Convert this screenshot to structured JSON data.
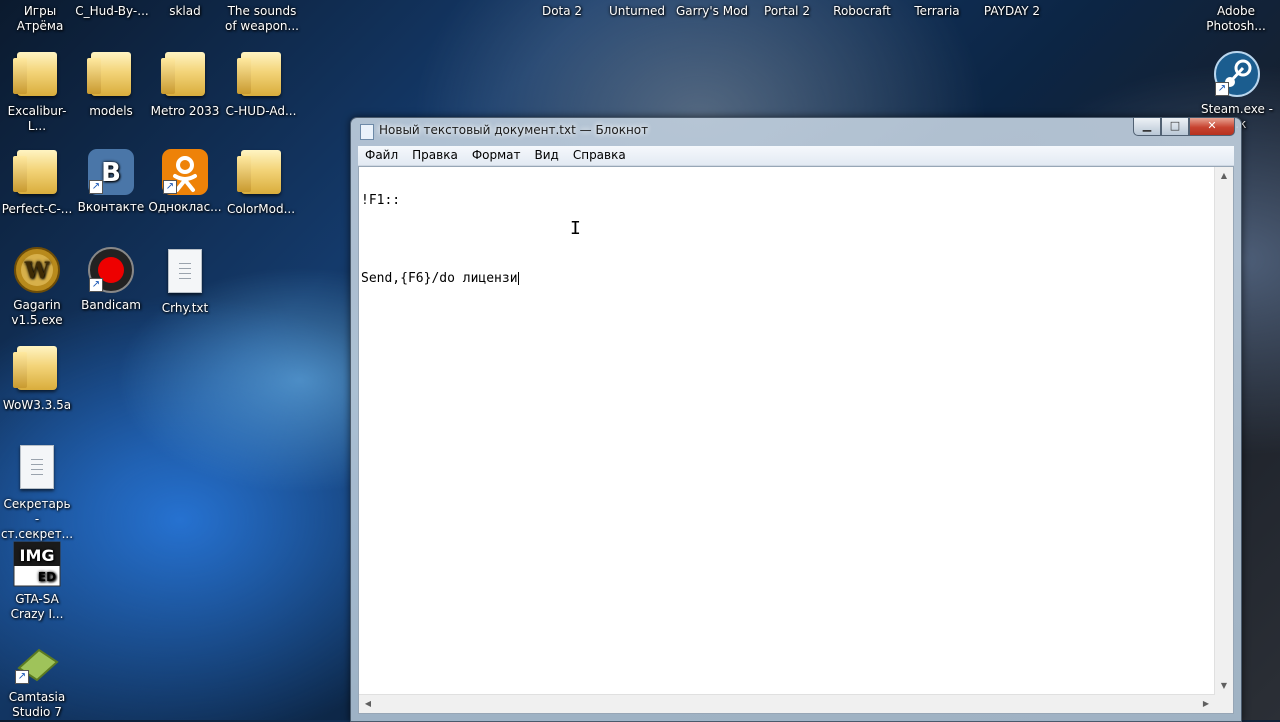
{
  "desktop": {
    "top_row": [
      {
        "label": "Игры Атрёма"
      },
      {
        "label": "C_Hud-By-..."
      },
      {
        "label": "sklad"
      },
      {
        "label": "The sounds of weapon..."
      },
      {
        "label": "Dota 2"
      },
      {
        "label": "Unturned"
      },
      {
        "label": "Garry's Mod"
      },
      {
        "label": "Portal 2"
      },
      {
        "label": "Robocraft"
      },
      {
        "label": "Terraria"
      },
      {
        "label": "PAYDAY 2"
      },
      {
        "label": "Adobe Photosh..."
      }
    ],
    "icons": [
      {
        "label": "Excalibur-L...",
        "icon": "folder-icon"
      },
      {
        "label": "models",
        "icon": "folder-icon"
      },
      {
        "label": "Metro 2033",
        "icon": "folder-icon"
      },
      {
        "label": "C-HUD-Ad...",
        "icon": "folder-icon"
      },
      {
        "label": "Perfect-C-...",
        "icon": "folder-icon"
      },
      {
        "label": "Вконтакте",
        "icon": "vk-icon"
      },
      {
        "label": "Одноклас...",
        "icon": "odnoklassniki-icon"
      },
      {
        "label": "ColorMod...",
        "icon": "folder-icon"
      },
      {
        "label": "Gagarin v1.5.exe",
        "icon": "wow-icon"
      },
      {
        "label": "Bandicam",
        "icon": "bandicam-icon"
      },
      {
        "label": "Crhy.txt",
        "icon": "text-file-icon"
      },
      {
        "label": "WoW3.3.5a",
        "icon": "folder-icon"
      },
      {
        "label": "Секретарь - ст.секрет...",
        "icon": "text-file-icon"
      },
      {
        "label": "GTA-SA Crazy I...",
        "icon": "img-editor-icon"
      },
      {
        "label": "Camtasia Studio 7",
        "icon": "camtasia-icon"
      },
      {
        "label": "Steam.exe - ...к",
        "icon": "steam-icon"
      }
    ]
  },
  "notepad": {
    "title": "Новый текстовый документ.txt — Блокнот",
    "controls": {
      "minimize": "▁",
      "maximize": "□",
      "close": "✕"
    },
    "menu": [
      "Файл",
      "Правка",
      "Формат",
      "Вид",
      "Справка"
    ],
    "lines": [
      "!F1::",
      "",
      "Send,{F6}/do лицензи"
    ]
  }
}
